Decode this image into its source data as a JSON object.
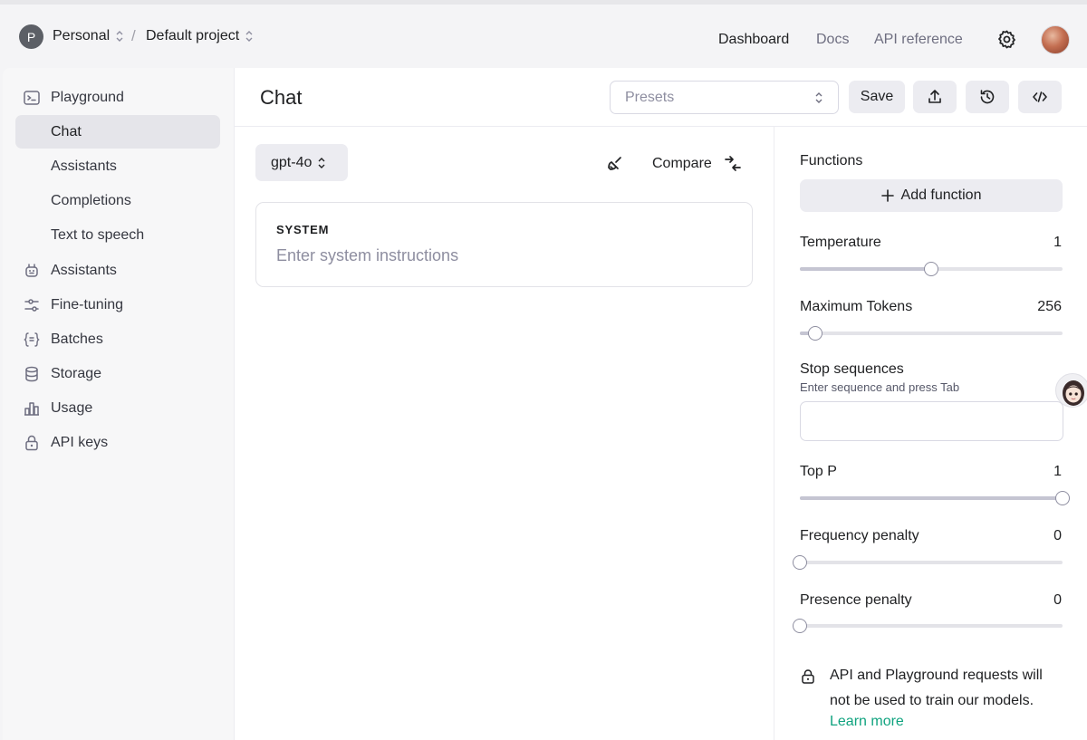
{
  "topbar": {
    "org_initial": "P",
    "org_name": "Personal",
    "separator": "/",
    "project_name": "Default project",
    "nav": [
      "Dashboard",
      "Docs",
      "API reference"
    ],
    "icons": [
      "gear-icon",
      "user-avatar"
    ]
  },
  "sidebar": {
    "items": [
      {
        "label": "Playground",
        "icon": "terminal-icon"
      },
      {
        "label": "Chat"
      },
      {
        "label": "Assistants"
      },
      {
        "label": "Completions"
      },
      {
        "label": "Text to speech"
      },
      {
        "label": "Assistants",
        "icon": "robot-icon"
      },
      {
        "label": "Fine-tuning",
        "icon": "sliders-icon"
      },
      {
        "label": "Batches",
        "icon": "braces-icon"
      },
      {
        "label": "Storage",
        "icon": "database-icon"
      },
      {
        "label": "Usage",
        "icon": "bar-chart-icon"
      },
      {
        "label": "API keys",
        "icon": "lock-icon"
      }
    ],
    "active": "Chat"
  },
  "header": {
    "title": "Chat",
    "presets_placeholder": "Presets",
    "save_label": "Save",
    "icons": [
      "upload-icon",
      "history-icon",
      "code-icon"
    ]
  },
  "chat": {
    "model": "gpt-4o",
    "compare_label": "Compare",
    "system_label": "SYSTEM",
    "system_placeholder": "Enter system instructions"
  },
  "settings": {
    "functions_label": "Functions",
    "add_function_label": "Add function",
    "temperature": {
      "label": "Temperature",
      "value": "1",
      "fraction": 0.5
    },
    "max_tokens": {
      "label": "Maximum Tokens",
      "value": "256",
      "fraction": 0.06
    },
    "stop_sequences": {
      "label": "Stop sequences",
      "hint": "Enter sequence and press Tab",
      "value": ""
    },
    "top_p": {
      "label": "Top P",
      "value": "1",
      "fraction": 1.0
    },
    "frequency_penalty": {
      "label": "Frequency penalty",
      "value": "0",
      "fraction": 0.0
    },
    "presence_penalty": {
      "label": "Presence penalty",
      "value": "0",
      "fraction": 0.0
    },
    "privacy_text": "API and Playground requests will not be used to train our models.",
    "learn_more": "Learn more"
  },
  "colors": {
    "accent_link": "#10a37f",
    "button_bg": "#ececf1",
    "active_nav_bg": "#e5e5ea"
  }
}
